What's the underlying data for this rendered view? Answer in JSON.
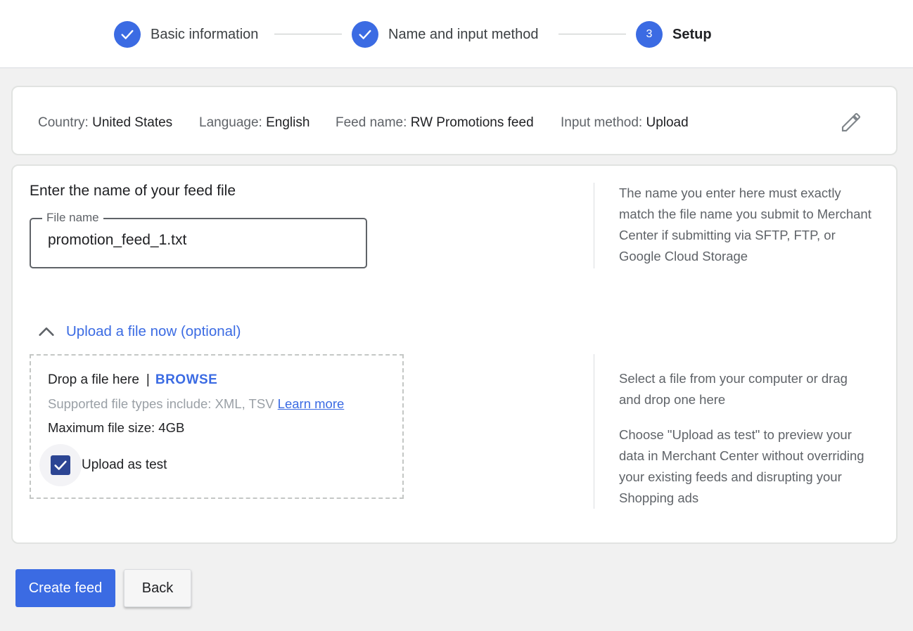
{
  "stepper": {
    "steps": [
      {
        "label": "Basic information",
        "state": "done"
      },
      {
        "label": "Name and input method",
        "state": "done"
      },
      {
        "label": "Setup",
        "state": "current",
        "number": "3"
      }
    ],
    "accent_color": "#3b6be3"
  },
  "summary": {
    "country_key": "Country:",
    "country_value": "United States",
    "language_key": "Language:",
    "language_value": "English",
    "feed_name_key": "Feed name:",
    "feed_name_value": "RW Promotions feed",
    "input_method_key": "Input method:",
    "input_method_value": "Upload",
    "edit_icon": "pencil-icon"
  },
  "file_name_section": {
    "title": "Enter the name of your feed file",
    "field_label": "File name",
    "field_value": "promotion_feed_1.txt",
    "help_text": "The name you enter here must exactly match the file name you submit to Merchant Center if submitting via SFTP, FTP, or Google Cloud Storage"
  },
  "upload_section": {
    "expander_label": "Upload a file now (optional)",
    "expander_icon": "chevron-up-icon",
    "drop_text": "Drop a file here",
    "separator": "|",
    "browse_label": "BROWSE",
    "supported_text": "Supported file types include: XML, TSV",
    "learn_more_label": "Learn more",
    "max_size_text": "Maximum file size: 4GB",
    "upload_as_test_label": "Upload as test",
    "upload_as_test_checked": true,
    "help_text_1": "Select a file from your computer or drag and drop one here",
    "help_text_2": "Choose \"Upload as test\" to preview your data in Merchant Center without overriding your existing feeds and disrupting your Shopping ads"
  },
  "actions": {
    "create_label": "Create feed",
    "back_label": "Back"
  }
}
